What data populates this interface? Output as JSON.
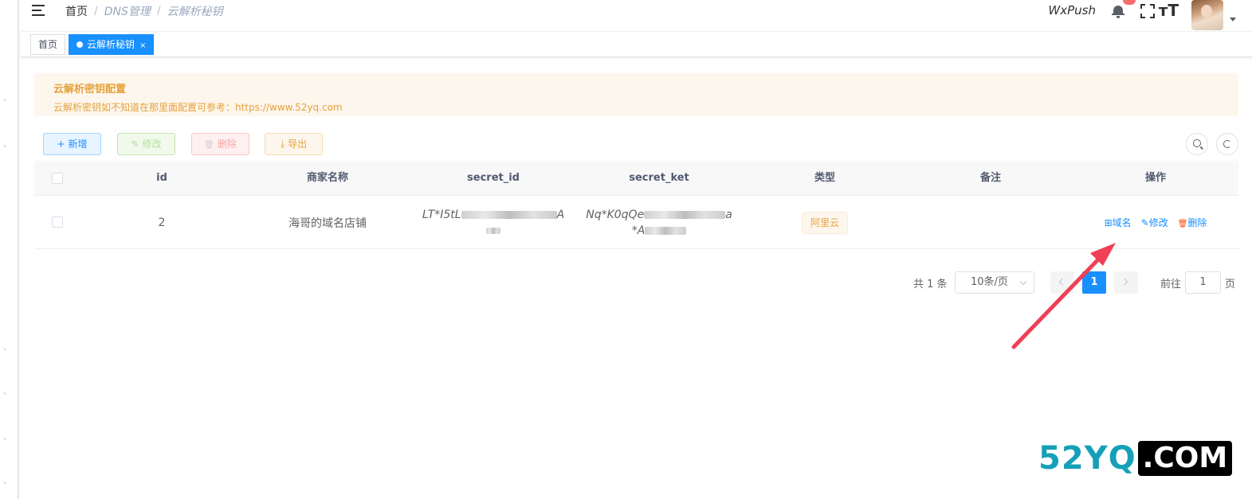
{
  "navbar": {
    "breadcrumb": [
      "首页",
      "DNS管理",
      "云解析秘钥"
    ],
    "breadcrumb_sep": "/",
    "app_name": "WxPush",
    "icons": [
      "hamburger-icon",
      "bell-icon",
      "fullscreen-icon",
      "font-size-icon",
      "avatar",
      "caret-down-icon"
    ]
  },
  "tags": [
    {
      "label": "首页",
      "active": false
    },
    {
      "label": "云解析秘钥",
      "active": true,
      "close": "×"
    }
  ],
  "alert": {
    "title": "云解析密钥配置",
    "description": "云解析密钥如不知道在那里面配置可参考：https://www.52yq.com"
  },
  "toolbar": {
    "add": {
      "icon": "+",
      "label": "新增"
    },
    "edit": {
      "icon": "✎",
      "label": "修改"
    },
    "delete": {
      "icon": "🗑",
      "label": "删除"
    },
    "export": {
      "icon": "⤓",
      "label": "导出"
    }
  },
  "table": {
    "columns": [
      "id",
      "商家名称",
      "secret_id",
      "secret_ket",
      "类型",
      "备注",
      "操作"
    ],
    "rows": [
      {
        "id": "2",
        "merchant": "海哥的域名店铺",
        "secret_id_line1": "LT*I5tL",
        "secret_id_line1_tail": "A",
        "secret_ket_line1": "Nq*K0qQe",
        "secret_ket_line1_tail": "a",
        "secret_ket_line2": "*A",
        "type": "阿里云",
        "remark": "",
        "actions": {
          "domain": {
            "icon": "⊞",
            "label": "域名"
          },
          "edit": {
            "icon": "✎",
            "label": "修改"
          },
          "delete": {
            "icon": "🗑",
            "label": "删除"
          }
        }
      }
    ]
  },
  "pagination": {
    "total_text": "共 1 条",
    "page_size": "10条/页",
    "current_page": "1",
    "goto_label": "前往",
    "goto_value": "1",
    "goto_suffix": "页"
  },
  "watermark": {
    "part1": "52YQ",
    "part2": ".COM",
    "colors": {
      "part1": "#16a0b8",
      "part2_bg": "#000000"
    }
  },
  "colors": {
    "primary": "#1890ff",
    "warning": "#e6a23c",
    "annotation_arrow": "#ef4056"
  }
}
